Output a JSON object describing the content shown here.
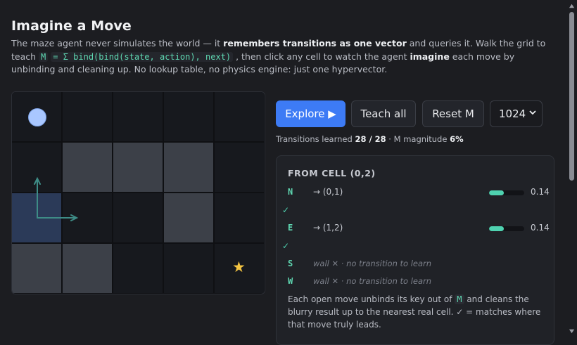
{
  "title": "Imagine a Move",
  "intro": {
    "t1": "The maze agent never simulates the world — it ",
    "b1": "remembers transitions as one vector",
    "t2": " and queries it. Walk the grid to teach ",
    "c1": "M",
    "t3": " ",
    "c2": "= Σ bind(bind(state, action), next)",
    "t4": " , then click any cell to watch the agent ",
    "b2": "imagine",
    "t5": " each move by unbinding and cleaning up. No lookup table, no physics engine: just one hypervector."
  },
  "grid": {
    "rows": 4,
    "cols": 5,
    "walls": [
      [
        1,
        1
      ],
      [
        1,
        2
      ],
      [
        1,
        3
      ],
      [
        2,
        3
      ],
      [
        3,
        0
      ],
      [
        3,
        1
      ]
    ],
    "current": [
      2,
      0
    ],
    "agent": [
      0,
      0
    ],
    "goal": [
      3,
      4
    ],
    "goal_icon": "star-icon"
  },
  "controls": {
    "explore": "Explore ▶",
    "teach_all": "Teach all",
    "reset": "Reset M",
    "dimension": "1024"
  },
  "stats": {
    "learned_label": "Transitions learned",
    "learned_value": "28 / 28",
    "sep": " · M magnitude ",
    "magnitude": "6%"
  },
  "panel": {
    "heading": "FROM CELL (0,2)",
    "moves": [
      {
        "dir": "N",
        "target": "→ (0,1)",
        "value": "0.14",
        "level": 0.42,
        "check": "✓"
      },
      {
        "dir": "E",
        "target": "→ (1,2)",
        "value": "0.14",
        "level": 0.42,
        "check": "✓"
      },
      {
        "dir": "S",
        "wall": "wall ✕ · no transition to learn"
      },
      {
        "dir": "W",
        "wall": "wall ✕ · no transition to learn"
      }
    ],
    "note": {
      "t1": "Each open move unbinds its key out of ",
      "c1": "M",
      "t2": " and cleans the blurry result up to the nearest real cell. ✓ = matches where that move truly leads."
    }
  },
  "colors": {
    "accent": "#3d7bf5",
    "teal": "#4fd2b0",
    "wall": "#3c4048",
    "current": "#2b3a58",
    "agent": "#a9c7ff",
    "goal": "#f5c542"
  }
}
